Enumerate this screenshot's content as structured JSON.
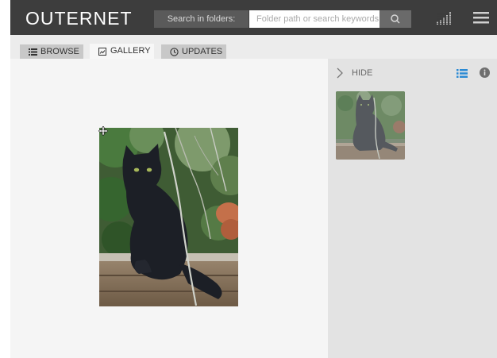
{
  "app": {
    "logo": "OUTERNET"
  },
  "search": {
    "label": "Search in folders:",
    "placeholder": "Folder path or search keywords",
    "button_icon": "search-icon"
  },
  "header_icons": {
    "signal": "signal-bars-icon",
    "menu": "hamburger-menu-icon"
  },
  "tabs": [
    {
      "label": "BROWSE",
      "icon": "list-icon",
      "active": false
    },
    {
      "label": "GALLERY",
      "icon": "image-icon",
      "active": true
    },
    {
      "label": "UPDATES",
      "icon": "clock-icon",
      "active": false
    }
  ],
  "sidepanel": {
    "hide_label": "HIDE",
    "view_icon": "list-view-icon",
    "info_icon": "info-icon",
    "accent_color": "#2a8ad4"
  },
  "gallery": {
    "image_subject": "black cat sitting on wooden rail",
    "thumbnail_subject": "black cat thumbnail"
  },
  "colors": {
    "topbar": "#3d3d3d",
    "main_bg": "#f5f5f5",
    "sidepanel_bg": "#e3e3e3"
  }
}
